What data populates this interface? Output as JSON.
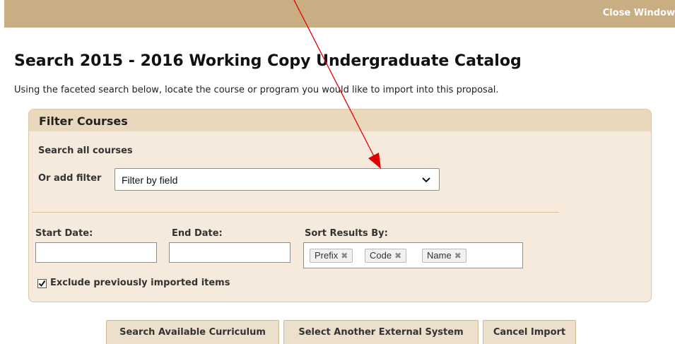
{
  "header": {
    "close_window_label": "Close Window"
  },
  "page": {
    "title": "Search 2015 - 2016 Working Copy Undergraduate Catalog",
    "instructions": "Using the faceted search below, locate the course or program you would like to import into this proposal."
  },
  "filter_panel": {
    "title": "Filter Courses",
    "search_all_label": "Search all courses",
    "add_filter_label": "Or add filter",
    "filter_select_value": "Filter by field",
    "start_date_label": "Start Date:",
    "start_date_value": "",
    "end_date_label": "End Date:",
    "end_date_value": "",
    "sort_label": "Sort Results By:",
    "sort_tags": [
      "Prefix",
      "Code",
      "Name"
    ],
    "exclude_label": "Exclude previously imported items",
    "exclude_checked": true
  },
  "actions": {
    "search_label": "Search Available Curriculum",
    "select_system_label": "Select Another External System",
    "cancel_label": "Cancel Import"
  },
  "colors": {
    "header_bar": "#c9ad83",
    "panel_bg": "#f5eadb",
    "panel_header": "#ead8bd",
    "annotation_arrow": "#e00000"
  },
  "icons": {
    "select_chevron": "chevron-down-icon",
    "tag_remove": "close-icon",
    "checkbox": "checkmark-icon"
  }
}
